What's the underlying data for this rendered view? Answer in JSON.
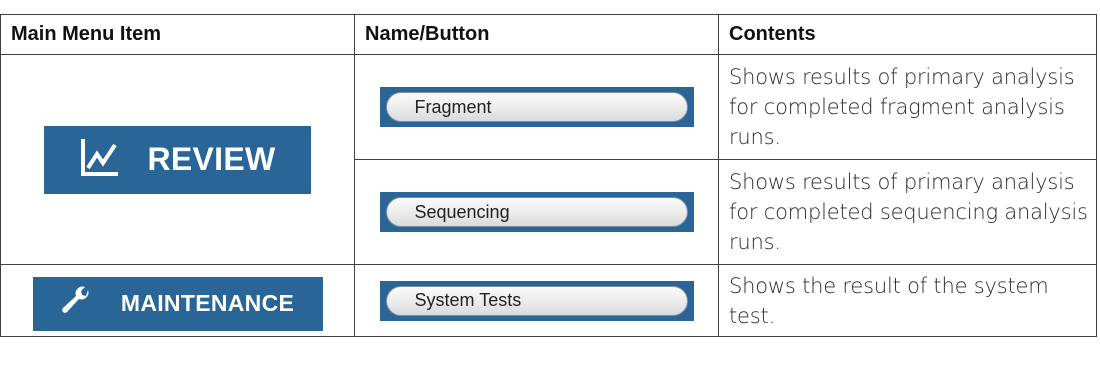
{
  "table": {
    "headers": [
      "Main Menu Item",
      "Name/Button",
      "Contents"
    ],
    "rows": [
      {
        "menu_item": {
          "label": "REVIEW",
          "icon": "line-chart-icon"
        },
        "button": "Fragment",
        "contents": "Shows results of primary analysis for completed fragment analysis runs."
      },
      {
        "button": "Sequencing",
        "contents": "Shows results of primary analysis for completed sequencing analysis runs."
      },
      {
        "menu_item": {
          "label": "MAINTENANCE",
          "icon": "wrench-icon"
        },
        "button": "System Tests",
        "contents": "Shows the result of the system test."
      }
    ]
  },
  "colors": {
    "banner_blue": "#2a6597",
    "border": "#404040"
  }
}
